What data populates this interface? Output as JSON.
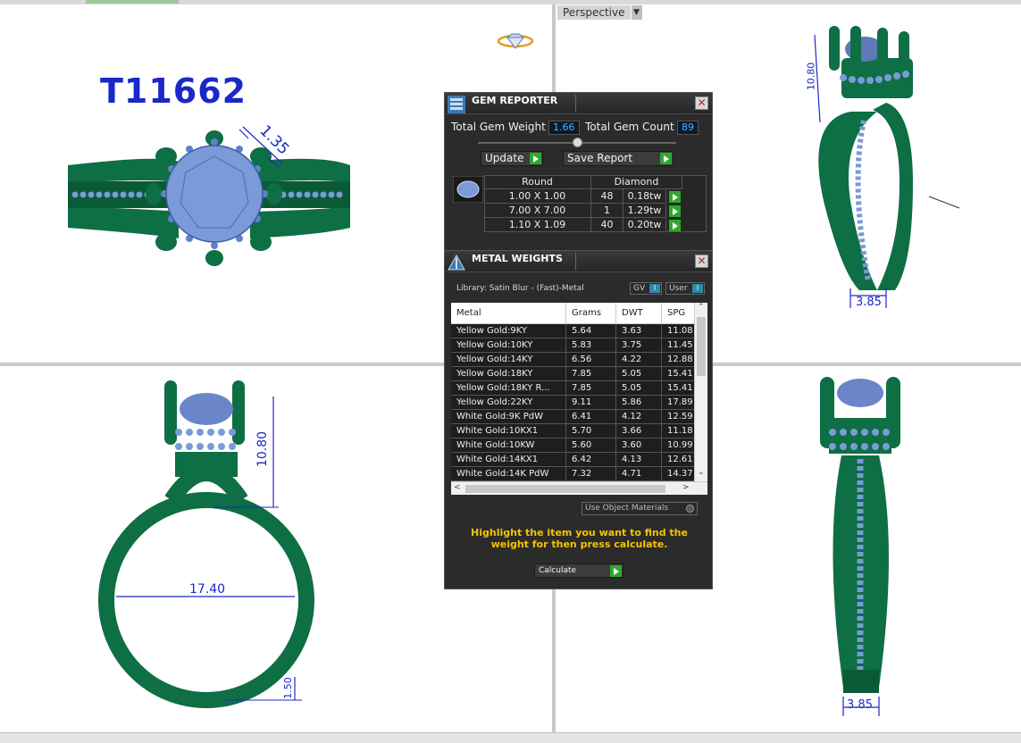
{
  "viewport": {
    "view_label": "Perspective",
    "part_code": "T11662",
    "dimensions": {
      "prong_width": "1.35",
      "top_view_height": "10.80",
      "side_height": "10.80",
      "ring_inner_diameter": "17.40",
      "shank_thickness": "1.50",
      "side_shank_width": "3.85",
      "front_shank_width": "3.85"
    }
  },
  "gem_reporter": {
    "title": "GEM REPORTER",
    "close_glyph": "✕",
    "total_weight_label": "Total Gem Weight",
    "total_weight_value": "1.66",
    "total_count_label": "Total Gem Count",
    "total_count_value": "89",
    "update_label": "Update",
    "save_report_label": "Save Report",
    "shape_header": "Round",
    "material_header": "Diamond",
    "rows": [
      {
        "size": "1.00 X 1.00",
        "count": "48",
        "weight": "0.18tw"
      },
      {
        "size": "7.00 X 7.00",
        "count": "1",
        "weight": "1.29tw"
      },
      {
        "size": "1.10 X 1.09",
        "count": "40",
        "weight": "0.20tw"
      }
    ]
  },
  "metal_weights": {
    "title": "METAL WEIGHTS",
    "close_glyph": "✕",
    "library_label": "Library: Satin Blur - (Fast)-Metal",
    "gv_label": "GV",
    "user_label": "User",
    "columns": [
      "Metal",
      "Grams",
      "DWT",
      "SPG"
    ],
    "rows": [
      {
        "metal": "Yellow Gold:9KY",
        "grams": "5.64",
        "dwt": "3.63",
        "spg": "11.08"
      },
      {
        "metal": "Yellow Gold:10KY",
        "grams": "5.83",
        "dwt": "3.75",
        "spg": "11.45"
      },
      {
        "metal": "Yellow Gold:14KY",
        "grams": "6.56",
        "dwt": "4.22",
        "spg": "12.88"
      },
      {
        "metal": "Yellow Gold:18KY",
        "grams": "7.85",
        "dwt": "5.05",
        "spg": "15.41"
      },
      {
        "metal": "Yellow Gold:18KY R...",
        "grams": "7.85",
        "dwt": "5.05",
        "spg": "15.41"
      },
      {
        "metal": "Yellow Gold:22KY",
        "grams": "9.11",
        "dwt": "5.86",
        "spg": "17.89"
      },
      {
        "metal": "White Gold:9K PdW",
        "grams": "6.41",
        "dwt": "4.12",
        "spg": "12.59"
      },
      {
        "metal": "White Gold:10KX1",
        "grams": "5.70",
        "dwt": "3.66",
        "spg": "11.18"
      },
      {
        "metal": "White Gold:10KW",
        "grams": "5.60",
        "dwt": "3.60",
        "spg": "10.99"
      },
      {
        "metal": "White Gold:14KX1",
        "grams": "6.42",
        "dwt": "4.13",
        "spg": "12.61"
      },
      {
        "metal": "White Gold:14K PdW",
        "grams": "7.32",
        "dwt": "4.71",
        "spg": "14.37"
      }
    ],
    "use_object_materials_label": "Use Object Materials",
    "hint_text": "Highlight the item you want to find the weight for then press calculate.",
    "calculate_label": "Calculate"
  },
  "colors": {
    "ring_green": "#0e6e44",
    "gem_blue": "#7a9ad8",
    "dimension_blue": "#1a28c8",
    "panel_bg": "#2b2b2b",
    "hint_yellow": "#f4c400",
    "go_green": "#2ea82e"
  }
}
